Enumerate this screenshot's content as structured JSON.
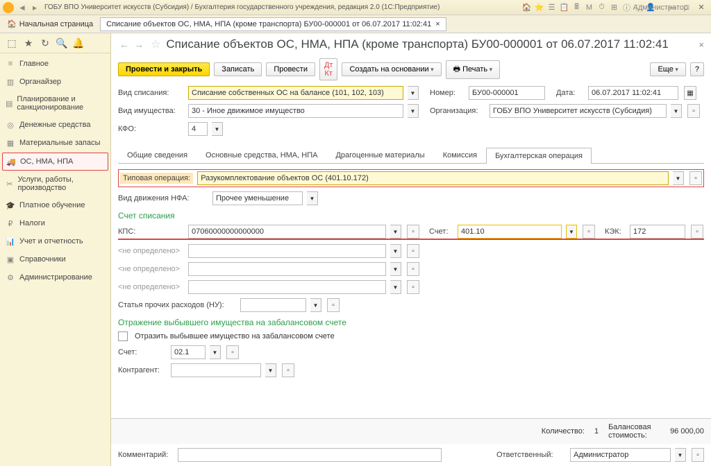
{
  "titlebar": {
    "title": "ГОБУ ВПО Университет искусств (Субсидия) / Бухгалтерия государственного учреждения, редакция 2.0  (1С:Предприятие)",
    "user": "Администратор"
  },
  "tabs": {
    "home": "Начальная страница",
    "doc": "Списание объектов ОС, НМА, НПА (кроме транспорта) БУ00-000001 от 06.07.2017 11:02:41"
  },
  "sidebar": {
    "items": [
      {
        "label": "Главное"
      },
      {
        "label": "Органайзер"
      },
      {
        "label": "Планирование и санкционирование"
      },
      {
        "label": "Денежные средства"
      },
      {
        "label": "Материальные запасы"
      },
      {
        "label": "ОС, НМА, НПА"
      },
      {
        "label": "Услуги, работы, производство"
      },
      {
        "label": "Платное обучение"
      },
      {
        "label": "Налоги"
      },
      {
        "label": "Учет и отчетность"
      },
      {
        "label": "Справочники"
      },
      {
        "label": "Администрирование"
      }
    ]
  },
  "doc": {
    "title": "Списание объектов ОС, НМА, НПА (кроме транспорта) БУ00-000001 от 06.07.2017 11:02:41",
    "toolbar": {
      "post_close": "Провести и закрыть",
      "save": "Записать",
      "post": "Провести",
      "create_based": "Создать на основании",
      "print": "Печать",
      "more": "Еще"
    },
    "header": {
      "kind_label": "Вид списания:",
      "kind_value": "Списание собственных ОС на балансе (101, 102, 103)",
      "num_label": "Номер:",
      "num_value": "БУ00-000001",
      "date_label": "Дата:",
      "date_value": "06.07.2017 11:02:41",
      "prop_label": "Вид имущества:",
      "prop_value": "30 - Иное движимое имущество",
      "org_label": "Организация:",
      "org_value": "ГОБУ ВПО Университет искусств (Субсидия)",
      "kfo_label": "КФО:",
      "kfo_value": "4"
    },
    "tabs2": [
      "Общие сведения",
      "Основные средства, НМА, НПА",
      "Драгоценные материалы",
      "Комиссия",
      "Бухгалтерская операция"
    ],
    "tab_active": 4,
    "op": {
      "type_label": "Типовая операция:",
      "type_value": "Разукомплектование объектов ОС (401.10.172)",
      "move_label": "Вид движения НФА:",
      "move_value": "Прочее уменьшение",
      "sect1": "Счет списания",
      "kps_label": "КПС:",
      "kps_value": "07060000000000000",
      "acc_label": "Счет:",
      "acc_value": "401.10",
      "kek_label": "КЭК:",
      "kek_value": "172",
      "ph": "<не определено>",
      "exp_label": "Статья прочих расходов (НУ):",
      "sect2": "Отражение выбывшего имущества на забалансовом счете",
      "chk_label": "Отразить выбывшее имущество на забалансовом счете",
      "acc2_label": "Счет:",
      "acc2_value": "02.1",
      "contr_label": "Контрагент:"
    },
    "footer": {
      "qty_label": "Количество:",
      "qty_value": "1",
      "bal_label": "Балансовая стоимость:",
      "bal_value": "96 000,00",
      "comment_label": "Комментарий:",
      "resp_label": "Ответственный:",
      "resp_value": "Администратор"
    }
  }
}
